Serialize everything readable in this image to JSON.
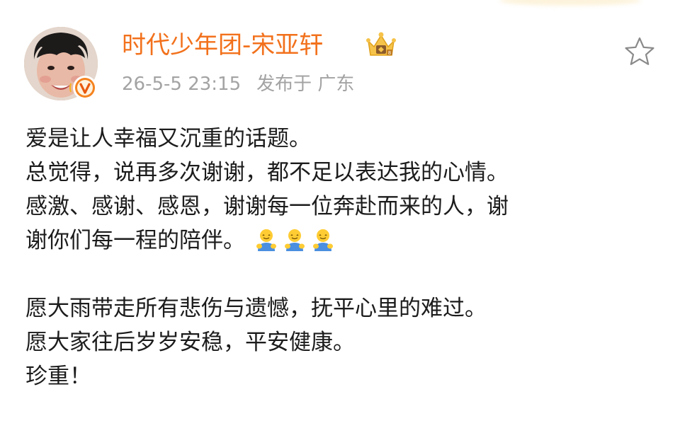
{
  "author": {
    "name": "时代少年团-宋亚轩",
    "avatar_alt": "avatar",
    "badge": "verified-v-badge",
    "rank_icon": "crown-icon"
  },
  "post_meta": {
    "time": "26-5-5 23:15",
    "location": "发布于 广东"
  },
  "actions": {
    "favorite_icon": "star-outline-icon"
  },
  "post": {
    "lines": [
      "爱是让人幸福又沉重的话题。",
      "总觉得，说再多次谢谢，都不足以表达我的心情。",
      "感激、感谢、感恩，谢谢每一位奔赴而来的人，谢",
      "谢你们每一程的陪伴。",
      "",
      "愿大雨带走所有悲伤与遗憾，抚平心里的难过。",
      "愿大家往后岁岁安稳，平安健康。",
      "珍重！"
    ],
    "emoji": [
      "hug-emoji",
      "hug-emoji",
      "hug-emoji"
    ]
  },
  "colors": {
    "username": "#f2711c",
    "meta": "#a3a3a3",
    "text": "#1c1c1c",
    "badge_orange": "#f5831f"
  }
}
